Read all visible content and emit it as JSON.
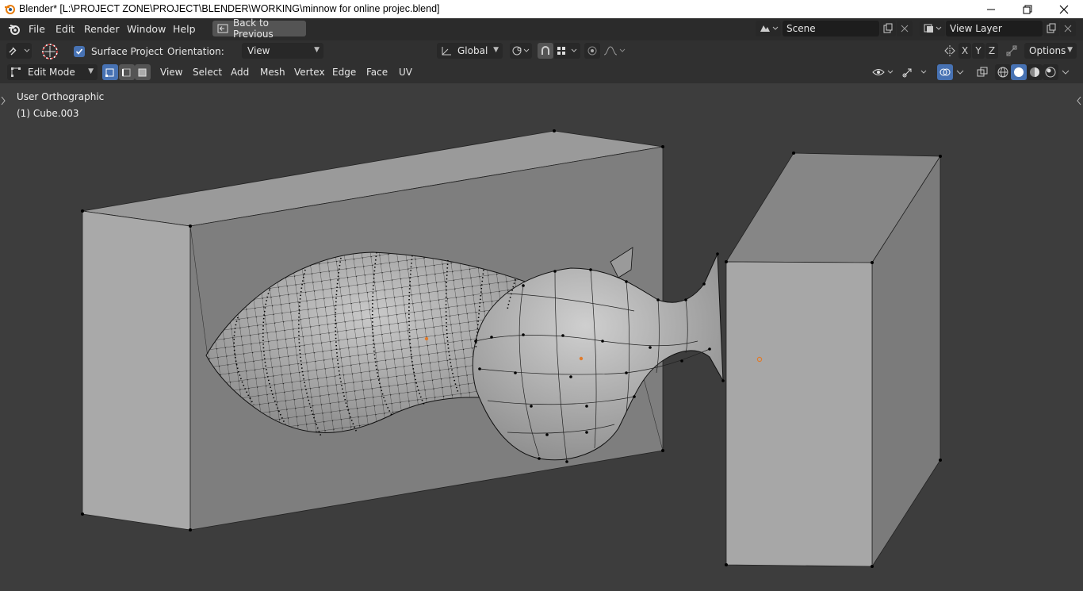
{
  "window": {
    "title": "Blender* [L:\\PROJECT ZONE\\PROJECT\\BLENDER\\WORKING\\minnow for online projec.blend]",
    "controls": [
      "minimize-icon",
      "restore-icon",
      "close-icon"
    ]
  },
  "menubar": {
    "items": [
      "File",
      "Edit",
      "Render",
      "Window",
      "Help"
    ],
    "back_button": "Back to Previous",
    "scene_name": "Scene",
    "view_layer": "View Layer"
  },
  "tool_header": {
    "surface_project_label": "Surface Project",
    "surface_project_checked": true,
    "orientation_label": "Orientation:",
    "orientation_value": "View",
    "transform_orientation": "Global",
    "axes": [
      "X",
      "Y",
      "Z"
    ],
    "options_label": "Options"
  },
  "viewport_header": {
    "mode": "Edit Mode",
    "menus": [
      "View",
      "Select",
      "Add",
      "Mesh",
      "Vertex",
      "Edge",
      "Face",
      "UV"
    ]
  },
  "viewport": {
    "view_name": "User Orthographic",
    "object_name": "(1) Cube.003"
  },
  "colors": {
    "accent": "#4772b3",
    "header_bg": "#303030",
    "viewport_bg": "#3d3d3d",
    "origin_dot": "#e07b2c"
  }
}
